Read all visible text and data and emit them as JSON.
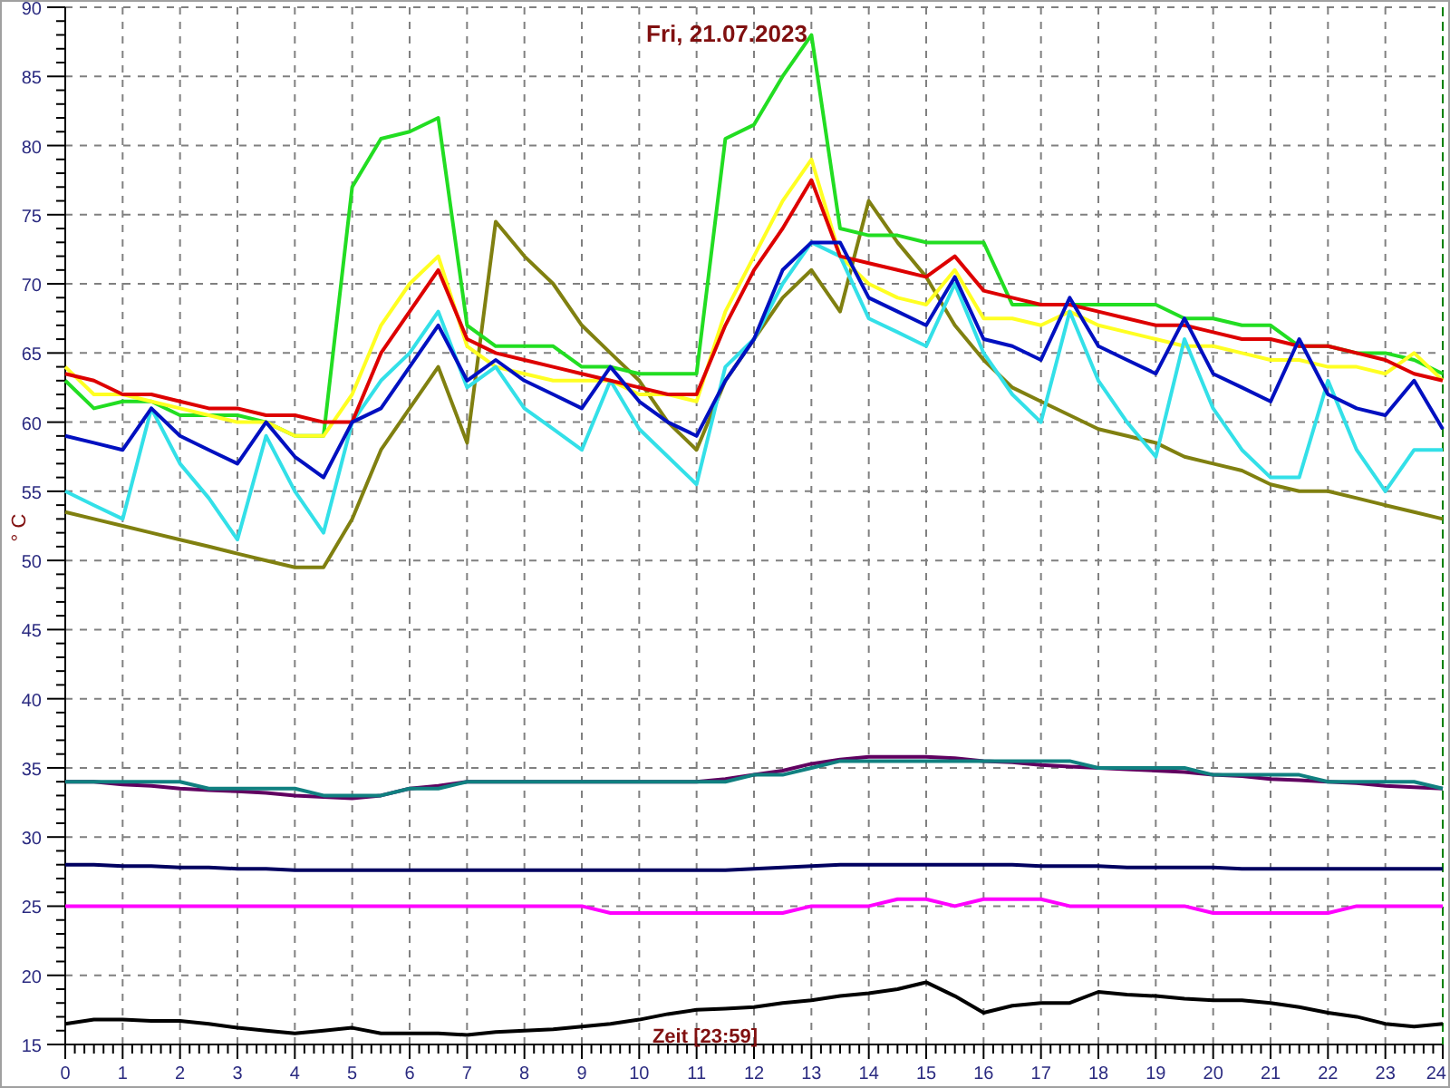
{
  "chart_data": {
    "type": "line",
    "title": "Fri, 21.07.2023",
    "xlabel": "Zeit [23:59]",
    "ylabel": "° C",
    "grid": true,
    "xlim": [
      0,
      24
    ],
    "ylim": [
      15,
      90
    ],
    "xticks": [
      0,
      1,
      2,
      3,
      4,
      5,
      6,
      7,
      8,
      9,
      10,
      11,
      12,
      13,
      14,
      15,
      16,
      17,
      18,
      19,
      20,
      21,
      22,
      23,
      24
    ],
    "yticks": [
      15,
      20,
      25,
      30,
      35,
      40,
      45,
      50,
      55,
      60,
      65,
      70,
      75,
      80,
      85,
      90
    ],
    "x": [
      0,
      0.5,
      1,
      1.5,
      2,
      2.5,
      3,
      3.5,
      4,
      4.5,
      5,
      5.5,
      6,
      6.5,
      7,
      7.5,
      8,
      8.5,
      9,
      9.5,
      10,
      10.5,
      11,
      11.5,
      12,
      12.5,
      13,
      13.5,
      14,
      14.5,
      15,
      15.5,
      16,
      16.5,
      17,
      17.5,
      18,
      18.5,
      19,
      19.5,
      20,
      20.5,
      21,
      21.5,
      22,
      22.5,
      23,
      23.5,
      24
    ],
    "series": [
      {
        "color": "#000000",
        "values": [
          16.5,
          16.8,
          16.8,
          16.7,
          16.7,
          16.5,
          16.2,
          16,
          15.8,
          16,
          16.2,
          15.8,
          15.8,
          15.8,
          15.7,
          15.9,
          16,
          16.1,
          16.3,
          16.5,
          16.8,
          17.2,
          17.5,
          17.6,
          17.7,
          18,
          18.2,
          18.5,
          18.7,
          19,
          19.5,
          18.5,
          17.3,
          17.8,
          18,
          18,
          18.8,
          18.6,
          18.5,
          18.3,
          18.2,
          18.2,
          18,
          17.7,
          17.3,
          17,
          16.5,
          16.3,
          16.5
        ]
      },
      {
        "color": "#ff00ff",
        "values": [
          25,
          25,
          25,
          25,
          25,
          25,
          25,
          25,
          25,
          25,
          25,
          25,
          25,
          25,
          25,
          25,
          25,
          25,
          25,
          24.5,
          24.5,
          24.5,
          24.5,
          24.5,
          24.5,
          24.5,
          25,
          25,
          25,
          25.5,
          25.5,
          25,
          25.5,
          25.5,
          25.5,
          25,
          25,
          25,
          25,
          25,
          24.5,
          24.5,
          24.5,
          24.5,
          24.5,
          25,
          25,
          25,
          25
        ]
      },
      {
        "color": "#000060",
        "values": [
          28,
          28,
          27.9,
          27.9,
          27.8,
          27.8,
          27.7,
          27.7,
          27.6,
          27.6,
          27.6,
          27.6,
          27.6,
          27.6,
          27.6,
          27.6,
          27.6,
          27.6,
          27.6,
          27.6,
          27.6,
          27.6,
          27.6,
          27.6,
          27.7,
          27.8,
          27.9,
          28,
          28,
          28,
          28,
          28,
          28,
          28,
          27.9,
          27.9,
          27.9,
          27.8,
          27.8,
          27.8,
          27.8,
          27.7,
          27.7,
          27.7,
          27.7,
          27.7,
          27.7,
          27.7,
          27.7
        ]
      },
      {
        "color": "#600060",
        "values": [
          34,
          34,
          33.8,
          33.7,
          33.5,
          33.4,
          33.3,
          33.2,
          33,
          32.9,
          32.8,
          33,
          33.5,
          33.7,
          34,
          34,
          34,
          34,
          34,
          34,
          34,
          34,
          34,
          34.2,
          34.5,
          34.8,
          35.3,
          35.6,
          35.8,
          35.8,
          35.8,
          35.7,
          35.5,
          35.4,
          35.2,
          35.1,
          35,
          34.9,
          34.8,
          34.7,
          34.5,
          34.4,
          34.2,
          34.1,
          34,
          33.9,
          33.7,
          33.6,
          33.5
        ]
      },
      {
        "color": "#108080",
        "values": [
          34,
          34,
          34,
          34,
          34,
          33.5,
          33.5,
          33.5,
          33.5,
          33,
          33,
          33,
          33.5,
          33.5,
          34,
          34,
          34,
          34,
          34,
          34,
          34,
          34,
          34,
          34,
          34.5,
          34.5,
          35,
          35.5,
          35.5,
          35.5,
          35.5,
          35.5,
          35.5,
          35.5,
          35.5,
          35.5,
          35,
          35,
          35,
          35,
          34.5,
          34.5,
          34.5,
          34.5,
          34,
          34,
          34,
          34,
          33.5
        ]
      },
      {
        "color": "#808010",
        "values": [
          53.5,
          53,
          52.5,
          52,
          51.5,
          51,
          50.5,
          50,
          49.5,
          49.5,
          53,
          58,
          61,
          64,
          58.5,
          74.5,
          72,
          70,
          67,
          65,
          63,
          60,
          58,
          63,
          66,
          69,
          71,
          68,
          76,
          73,
          70.5,
          67,
          64.5,
          62.5,
          61.5,
          60.5,
          59.5,
          59,
          58.5,
          57.5,
          57,
          56.5,
          55.5,
          55,
          55,
          54.5,
          54,
          53.5,
          53
        ]
      },
      {
        "color": "#22dd22",
        "values": [
          63,
          61,
          61.5,
          61.5,
          60.5,
          60.5,
          60.5,
          60,
          59,
          59,
          77,
          80.5,
          81,
          82,
          67,
          65.5,
          65.5,
          65.5,
          64,
          64,
          63.5,
          63.5,
          63.5,
          80.5,
          81.5,
          85,
          88,
          74,
          73.5,
          73.5,
          73,
          73,
          73,
          68.5,
          68.5,
          68.5,
          68.5,
          68.5,
          68.5,
          67.5,
          67.5,
          67,
          67,
          65.5,
          65.5,
          65,
          65,
          64.5,
          63.5
        ]
      },
      {
        "color": "#ffff22",
        "values": [
          64,
          62,
          62,
          61.5,
          61,
          60.5,
          60,
          60,
          59,
          59,
          62,
          67,
          70,
          72,
          65.5,
          64,
          63.5,
          63,
          63,
          63,
          62,
          62,
          61.5,
          68,
          72,
          76,
          79,
          72,
          70,
          69,
          68.5,
          71,
          67.5,
          67.5,
          67,
          68,
          67,
          66.5,
          66,
          65.5,
          65.5,
          65,
          64.5,
          64.5,
          64,
          64,
          63.5,
          65,
          63
        ]
      },
      {
        "color": "#33e0e8",
        "values": [
          55,
          54,
          53,
          61,
          57,
          54.5,
          51.5,
          59,
          55,
          52,
          60,
          63,
          65,
          68,
          62.5,
          64,
          61,
          59.5,
          58,
          63,
          59.5,
          57.5,
          55.5,
          64,
          66,
          70,
          73,
          72,
          67.5,
          66.5,
          65.5,
          70,
          65,
          62,
          60,
          68,
          63,
          60,
          57.5,
          66,
          61,
          58,
          56,
          56,
          63,
          58,
          55,
          58,
          58
        ]
      },
      {
        "color": "#dd0000",
        "values": [
          63.5,
          63,
          62,
          62,
          61.5,
          61,
          61,
          60.5,
          60.5,
          60,
          60,
          65,
          68,
          71,
          66,
          65,
          64.5,
          64,
          63.5,
          63,
          62.5,
          62,
          62,
          67,
          71,
          74,
          77.5,
          72,
          71.5,
          71,
          70.5,
          72,
          69.5,
          69,
          68.5,
          68.5,
          68,
          67.5,
          67,
          67,
          66.5,
          66,
          66,
          65.5,
          65.5,
          65,
          64.5,
          63.5,
          63
        ]
      },
      {
        "color": "#0010c0",
        "values": [
          59,
          58.5,
          58,
          61,
          59,
          58,
          57,
          60,
          57.5,
          56,
          60,
          61,
          64,
          67,
          63,
          64.5,
          63,
          62,
          61,
          64,
          61.5,
          60,
          59,
          63,
          66,
          71,
          73,
          73,
          69,
          68,
          67,
          70.5,
          66,
          65.5,
          64.5,
          69,
          65.5,
          64.5,
          63.5,
          67.5,
          63.5,
          62.5,
          61.5,
          66,
          62,
          61,
          60.5,
          63,
          59.5
        ]
      }
    ]
  }
}
